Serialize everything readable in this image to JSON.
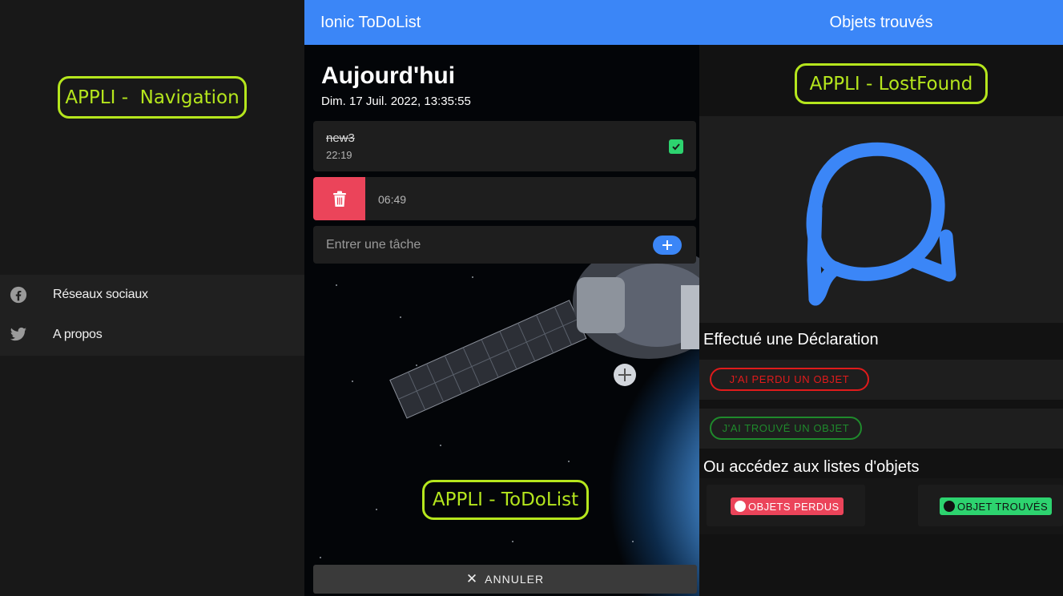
{
  "annotations": {
    "navigation": "APPLI -  Navigation",
    "todolist": "APPLI - ToDoList",
    "lostfound": "APPLI - LostFound"
  },
  "nav": {
    "items": [
      {
        "label": "Réseaux sociaux",
        "icon": "facebook-icon"
      },
      {
        "label": "A propos",
        "icon": "twitter-icon"
      }
    ]
  },
  "todo": {
    "header_title": "Ionic ToDoList",
    "section_title": "Aujourd'hui",
    "date": "Dim. 17 Juil. 2022, 13:35:55",
    "tasks": [
      {
        "name": "new3",
        "time": "22:19",
        "done": true
      },
      {
        "name": "",
        "time": "06:49",
        "done": false
      }
    ],
    "new_task_placeholder": "Entrer une tâche",
    "cancel_label": "ANNULER"
  },
  "lostfound": {
    "header_title": "Objets trouvés",
    "declaration_heading": "Effectué une Déclaration",
    "lost_button": "J'AI PERDU UN OBJET",
    "found_button": "J'AI TROUVÉ UN OBJET",
    "lists_heading": "Ou accédez aux listes d'objets",
    "lost_list_chip": "OBJETS PERDUS",
    "found_list_chip": "OBJET TROUVÉS"
  },
  "colors": {
    "accent": "#3b86f7",
    "annotation": "#b5e61d",
    "danger": "#eb445a",
    "success": "#2dd36f"
  }
}
